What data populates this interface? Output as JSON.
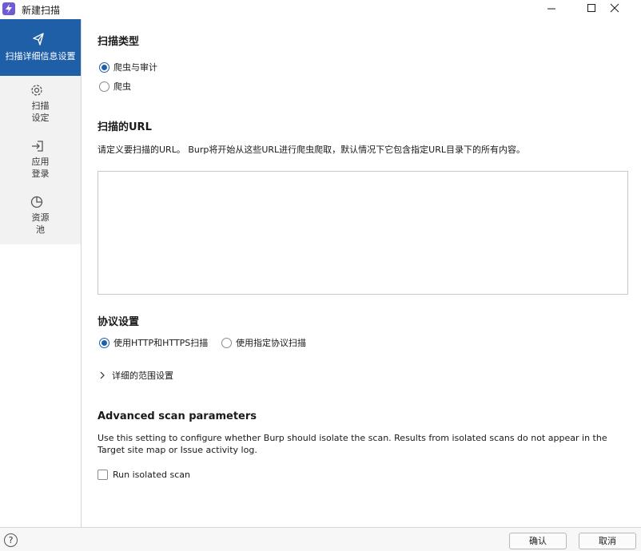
{
  "window": {
    "title": "新建扫描"
  },
  "sidebar": {
    "items": [
      {
        "label": "扫描详细信息设置",
        "icon": "send-icon",
        "active": true
      },
      {
        "label": "扫描\n设定",
        "icon": "gear-icon",
        "active": false
      },
      {
        "label": "应用\n登录",
        "icon": "login-icon",
        "active": false
      },
      {
        "label": "资源\n池",
        "icon": "pie-chart-icon",
        "active": false
      }
    ]
  },
  "scan_type": {
    "heading": "扫描类型",
    "options": [
      {
        "label": "爬虫与审计",
        "selected": true
      },
      {
        "label": "爬虫",
        "selected": false
      }
    ]
  },
  "urls": {
    "heading": "扫描的URL",
    "description": "请定义要扫描的URL。 Burp将开始从这些URL进行爬虫爬取，默认情况下它包含指定URL目录下的所有内容。",
    "value": ""
  },
  "protocol": {
    "heading": "协议设置",
    "options": [
      {
        "label": "使用HTTP和HTTPS扫描",
        "selected": true
      },
      {
        "label": "使用指定协议扫描",
        "selected": false
      }
    ],
    "expander_label": "详细的范围设置"
  },
  "advanced": {
    "heading": "Advanced scan parameters",
    "description": "Use this setting to configure whether Burp should isolate the scan. Results from isolated scans do not appear in the Target site map or Issue activity log.",
    "checkbox_label": "Run isolated scan",
    "checked": false
  },
  "footer": {
    "ok_label": "确认",
    "cancel_label": "取消",
    "help_glyph": "?"
  },
  "colors": {
    "accent": "#1f5fa8",
    "app_icon": "#6f5bd6"
  }
}
